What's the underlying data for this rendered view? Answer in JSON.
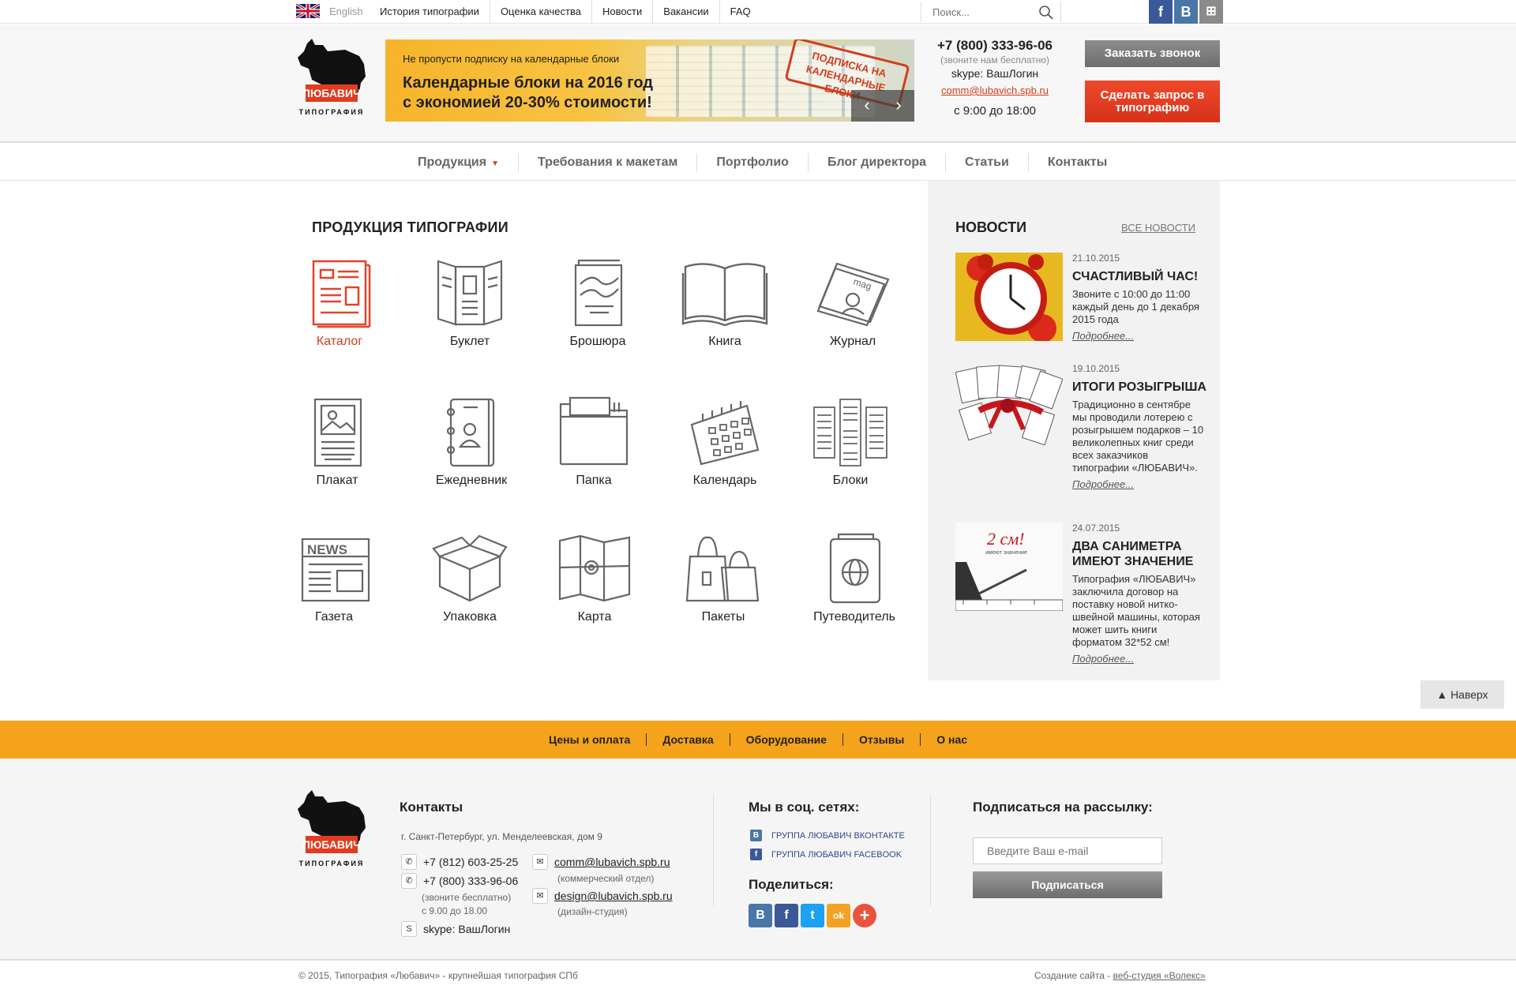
{
  "topbar": {
    "lang": "English",
    "nav": [
      "История типографии",
      "Оценка качества",
      "Новости",
      "Вакансии",
      "FAQ"
    ],
    "search_placeholder": "Поиск...",
    "social": [
      {
        "name": "facebook-icon",
        "glyph": "f",
        "color": "#3b5998"
      },
      {
        "name": "vk-icon",
        "glyph": "B",
        "color": "#4a76a8"
      },
      {
        "name": "sitemap-icon",
        "glyph": "⊞",
        "color": "#8a8a8a"
      }
    ]
  },
  "header": {
    "logo_text": "ЛЮБАВИЧ",
    "logo_sub": "ТИПОГРАФИЯ",
    "banner": {
      "subtitle": "Не пропусти подписку на календарные блоки",
      "title": "Календарные блоки на 2016 год с экономией 20-30% стоимости!",
      "stamp": "ПОДПИСКА НА КАЛЕНДАРНЫЕ БЛОКИ",
      "prev": "‹",
      "next": "›"
    },
    "phone": "+7 (800) 333-96-06",
    "phone_note": "(звоните нам бесплатно)",
    "skype": "skype:  ВашЛогин",
    "email": "comm@lubavich.spb.ru",
    "hours": "с 9:00 до 18:00",
    "call_button": "Заказать звонок",
    "request_button": "Сделать запрос в типографию"
  },
  "mainnav": {
    "items": [
      "Продукция",
      "Требования к макетам",
      "Портфолио",
      "Блог директора",
      "Статьи",
      "Контакты"
    ],
    "dropdown_marker": "▼"
  },
  "products": {
    "title": "ПРОДУКЦИЯ ТИПОГРАФИИ",
    "items": [
      {
        "label": "Каталог",
        "icon": "catalog-icon",
        "active": true
      },
      {
        "label": "Буклет",
        "icon": "booklet-icon"
      },
      {
        "label": "Брошюра",
        "icon": "brochure-icon"
      },
      {
        "label": "Книга",
        "icon": "book-icon"
      },
      {
        "label": "Журнал",
        "icon": "magazine-icon"
      },
      {
        "label": "Плакат",
        "icon": "poster-icon"
      },
      {
        "label": "Ежедневник",
        "icon": "planner-icon"
      },
      {
        "label": "Папка",
        "icon": "folder-icon"
      },
      {
        "label": "Календарь",
        "icon": "calendar-icon"
      },
      {
        "label": "Блоки",
        "icon": "blocks-icon"
      },
      {
        "label": "Газета",
        "icon": "newspaper-icon"
      },
      {
        "label": "Упаковка",
        "icon": "box-icon"
      },
      {
        "label": "Карта",
        "icon": "map-icon"
      },
      {
        "label": "Пакеты",
        "icon": "bags-icon"
      },
      {
        "label": "Путеводитель",
        "icon": "guide-icon"
      }
    ]
  },
  "news": {
    "title": "НОВОСТИ",
    "all_link": "ВСЕ НОВОСТИ",
    "more": "Подробнее...",
    "items": [
      {
        "date": "21.10.2015",
        "title": "СЧАСТЛИВЫЙ ЧАС!",
        "text": "Звоните с 10:00 до 11:00 каждый день до 1 декабря 2015 года",
        "image": "alarm-clock-image"
      },
      {
        "date": "19.10.2015",
        "title": "ИТОГИ РОЗЫГРЫША",
        "text": "Традиционно в сентябре мы проводили лотерею с розыгрышем подарков – 10 великолепных книг среди всех заказчиков типографии «ЛЮБАВИЧ».",
        "image": "books-gift-image"
      },
      {
        "date": "24.07.2015",
        "title": "ДВА САНИМЕТРА ИМЕЮТ ЗНАЧЕНИЕ",
        "text": "Типография «ЛЮБАВИЧ» заключила договор на поставку новой нитко-швейной машины, которая может шить книги форматом 32*52 см!",
        "image": "ruler-image",
        "image_text": "2 см!",
        "image_sub": "имеют значение"
      }
    ]
  },
  "to_top": "▲ Наверх",
  "footer_nav": [
    "Цены и оплата",
    "Доставка",
    "Оборудование",
    "Отзывы",
    "О нас"
  ],
  "footer": {
    "contacts_title": "Контакты",
    "address": "г. Санкт-Петербург, ул. Менделеевская, дом 9",
    "phone1": "+7 (812) 603-25-25",
    "phone2": "+7 (800) 333-96-06",
    "phone2_note": "(звоните бесплатно)",
    "hours": "с 9.00 до 18.00",
    "skype": "skype: ВашЛогин",
    "email1": "comm@lubavich.spb.ru",
    "email1_note": "(коммерческий отдел)",
    "email2": "design@lubavich.spb.ru",
    "email2_note": "(дизайн-студия)",
    "social_title": "Мы в соц. сетях:",
    "vk_group": "ГРУППА ЛЮБАВИЧ ВКОНТАКТЕ",
    "fb_group": "ГРУППА ЛЮБАВИЧ FACEBOOK",
    "share_title": "Поделиться:",
    "share": [
      {
        "name": "share-vk-icon",
        "glyph": "B",
        "color": "#4a76a8"
      },
      {
        "name": "share-facebook-icon",
        "glyph": "f",
        "color": "#3b5998"
      },
      {
        "name": "share-twitter-icon",
        "glyph": "t",
        "color": "#1da1f2"
      },
      {
        "name": "share-odnoklassniki-icon",
        "glyph": "ok",
        "color": "#f2a223"
      },
      {
        "name": "share-more-icon",
        "glyph": "+",
        "color": "#e8533e"
      }
    ],
    "subscribe_title": "Подписаться на рассылку:",
    "email_placeholder": "Введите Ваш e-mail",
    "subscribe_button": "Подписаться"
  },
  "copyright": "© 2015, Типография «Любавич» - крупнейшая типография СПб",
  "credit_prefix": "Создание сайта - ",
  "credit_link": "веб-студия «Волекс»"
}
